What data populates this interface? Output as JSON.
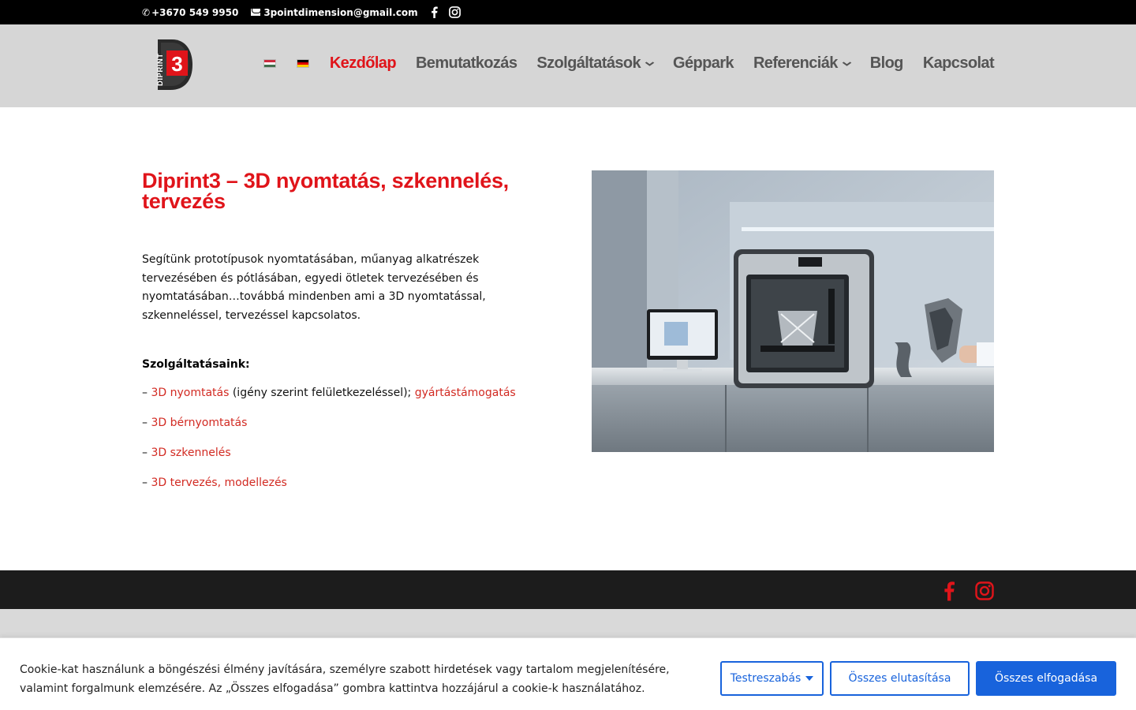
{
  "topbar": {
    "phone": "+3670 549 9950",
    "email": "3pointdimension@gmail.com",
    "icons": [
      "phone-icon",
      "mail-icon",
      "facebook-icon",
      "instagram-icon"
    ]
  },
  "header": {
    "logo_text": "DIPRINT",
    "logo_digit": "3",
    "languages": [
      "hu-flag",
      "de-flag"
    ],
    "nav": [
      {
        "label": "Kezdőlap",
        "active": true
      },
      {
        "label": "Bemutatkozás"
      },
      {
        "label": "Szolgáltatások",
        "has_dropdown": true
      },
      {
        "label": "Géppark"
      },
      {
        "label": "Referenciák",
        "has_dropdown": true
      },
      {
        "label": "Blog"
      },
      {
        "label": "Kapcsolat"
      }
    ],
    "chevron": "‹"
  },
  "main": {
    "title": "Diprint3 – 3D nyomtatás, szkennelés, tervezés",
    "intro": "Segítünk prototípusok nyomtatásában, műanyag alkatrészek tervezésében és pótlásában, egyedi ötletek tervezésében és nyomtatásában…továbbá mindenben ami a 3D nyomtatással, szkenneléssel, tervezéssel kapcsolatos.",
    "services_heading": "Szolgáltatásaink:",
    "dash": "–",
    "services": [
      {
        "link": "3D nyomtatás",
        "text": " (igény szerint felületkezeléssel); ",
        "link2": "gyártástámogatás"
      },
      {
        "link": "3D bérnyomtatás"
      },
      {
        "link": "3D szkennelés"
      },
      {
        "link": "3D tervezés, modellezés"
      }
    ]
  },
  "footer": {
    "icons": [
      "facebook-icon",
      "instagram-icon"
    ]
  },
  "cookie": {
    "text": "Cookie-kat használunk a böngészési élmény javítására, személyre szabott hirdetések vagy tartalom megjelenítésére, valamint forgalmunk elemzésére. Az „Összes elfogadása” gombra kattintva hozzájárul a cookie-k használatához.",
    "customize": "Testreszabás",
    "reject": "Összes elutasítása",
    "accept": "Összes elfogadása"
  },
  "colors": {
    "accent_red": "#e0141a",
    "cookie_blue": "#1863dc",
    "topbar": "#000000",
    "header_bg": "#d6d6d6",
    "footer_bg": "#1c1c1c"
  }
}
